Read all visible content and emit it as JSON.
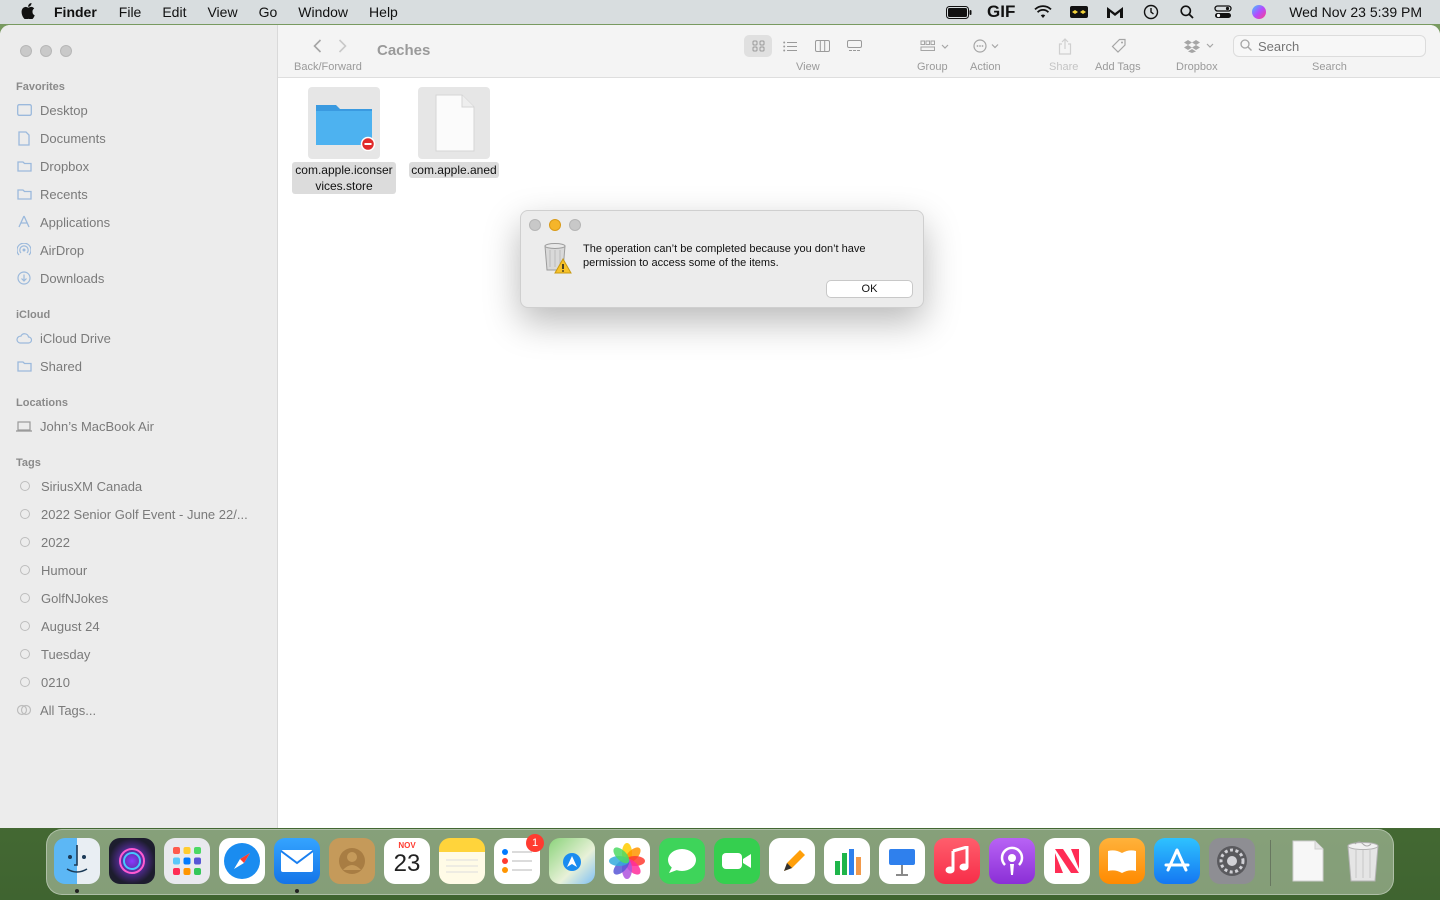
{
  "menubar": {
    "app_name": "Finder",
    "items": [
      "File",
      "Edit",
      "View",
      "Go",
      "Window",
      "Help"
    ],
    "status_icons": [
      "battery-icon",
      "gif-icon",
      "wifi-icon",
      "dropbox-status-icon",
      "malwarebytes-icon",
      "time-machine-icon",
      "spotlight-icon",
      "control-center-icon",
      "siri-icon"
    ],
    "gif_label": "GIF",
    "clock": "Wed Nov 23  5:39 PM"
  },
  "toolbar": {
    "back_forward_label": "Back/Forward",
    "title": "Caches",
    "view_label": "View",
    "group_label": "Group",
    "action_label": "Action",
    "share_label": "Share",
    "add_tags_label": "Add Tags",
    "dropbox_label": "Dropbox",
    "search_label": "Search",
    "search_placeholder": "Search"
  },
  "sidebar": {
    "favorites_header": "Favorites",
    "favorites": [
      {
        "label": "Desktop",
        "icon": "desktop-icon"
      },
      {
        "label": "Documents",
        "icon": "document-icon"
      },
      {
        "label": "Dropbox",
        "icon": "folder-icon"
      },
      {
        "label": "Recents",
        "icon": "folder-icon"
      },
      {
        "label": "Applications",
        "icon": "applications-icon"
      },
      {
        "label": "AirDrop",
        "icon": "airdrop-icon"
      },
      {
        "label": "Downloads",
        "icon": "downloads-icon"
      }
    ],
    "icloud_header": "iCloud",
    "icloud": [
      {
        "label": "iCloud Drive",
        "icon": "cloud-icon"
      },
      {
        "label": "Shared",
        "icon": "shared-folder-icon"
      }
    ],
    "locations_header": "Locations",
    "locations": [
      {
        "label": "John’s MacBook Air",
        "icon": "laptop-icon"
      }
    ],
    "tags_header": "Tags",
    "tags": [
      "SiriusXM Canada",
      "2022 Senior Golf Event - June 22/...",
      "2022",
      "Humour",
      "GolfNJokes",
      "August 24",
      "Tuesday",
      "0210",
      "All Tags..."
    ]
  },
  "files": [
    {
      "name": "com.apple.iconservices.store",
      "icon": "folder-restricted-icon"
    },
    {
      "name": "com.apple.aned",
      "icon": "blank-document-icon"
    }
  ],
  "alert": {
    "message": "The operation can’t be completed because you don’t have permission to access some of the items.",
    "ok_label": "OK",
    "icon": "trash-warning-icon"
  },
  "dock": {
    "apps": [
      "finder-icon",
      "siri-icon",
      "launchpad-icon",
      "safari-icon",
      "mail-icon",
      "contacts-icon",
      "calendar-icon",
      "notes-icon",
      "reminders-icon",
      "maps-icon",
      "photos-icon",
      "messages-icon",
      "facetime-icon",
      "pages-icon",
      "numbers-icon",
      "keynote-icon",
      "music-icon",
      "podcasts-icon",
      "news-icon",
      "books-icon",
      "app-store-icon",
      "system-preferences-icon",
      "document-icon",
      "trash-icon"
    ],
    "calendar_month": "NOV",
    "calendar_day": "23",
    "reminders_badge": "1"
  },
  "colors": {
    "accent": "#1e90ff",
    "sidebar_bg": "#ececec",
    "alert_bg": "#ececec"
  }
}
